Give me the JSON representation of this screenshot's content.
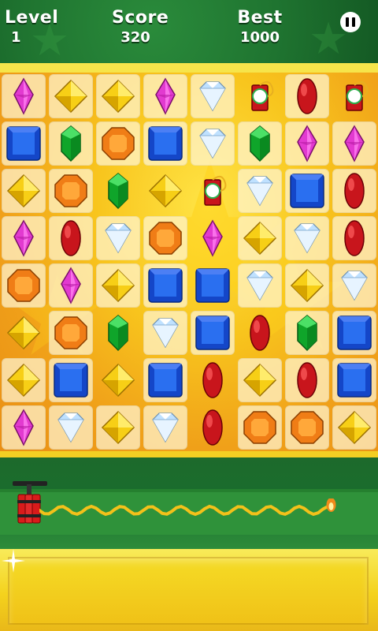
{
  "hud": {
    "level_label": "Level",
    "level_value": "1",
    "score_label": "Score",
    "score_value": "320",
    "best_label": "Best",
    "best_value": "1000",
    "pause_icon": "pause-icon"
  },
  "board": {
    "rows": 8,
    "cols": 8,
    "grid": [
      [
        "pink",
        "yellow",
        "yellow",
        "pink",
        "diamond",
        "bomb",
        "red",
        "bomb"
      ],
      [
        "blue",
        "green",
        "orange",
        "blue",
        "diamond",
        "green",
        "pink",
        "pink"
      ],
      [
        "yellow",
        "orange",
        "green",
        "yellow",
        "bomb",
        "diamond",
        "blue",
        "red"
      ],
      [
        "pink",
        "red",
        "diamond",
        "orange",
        "pink",
        "yellow",
        "diamond",
        "red"
      ],
      [
        "orange",
        "pink",
        "yellow",
        "blue",
        "blue",
        "diamond",
        "yellow",
        "diamond"
      ],
      [
        "yellow",
        "orange",
        "green",
        "diamond",
        "blue",
        "red",
        "green",
        "blue"
      ],
      [
        "yellow",
        "blue",
        "yellow",
        "blue",
        "red",
        "yellow",
        "red",
        "blue"
      ],
      [
        "pink",
        "diamond",
        "yellow",
        "diamond",
        "red",
        "orange",
        "orange",
        "yellow"
      ]
    ],
    "empty_tiles": [
      [
        0,
        5
      ],
      [
        0,
        7
      ],
      [
        2,
        4
      ],
      [
        3,
        4
      ],
      [
        4,
        4
      ],
      [
        5,
        5
      ],
      [
        6,
        4
      ],
      [
        7,
        4
      ],
      [
        2,
        2
      ],
      [
        2,
        3
      ],
      [
        5,
        0
      ],
      [
        5,
        2
      ],
      [
        6,
        2
      ]
    ],
    "colors": {
      "pink": "#e23ad0",
      "yellow": "#f7cf16",
      "blue": "#1446c8",
      "green": "#0fa52a",
      "orange": "#f07d16",
      "red": "#c8151c",
      "diamond": "#bfe1ff"
    }
  },
  "fuse": {
    "icon": "dynamite-icon",
    "progress_fraction": 0.95
  }
}
